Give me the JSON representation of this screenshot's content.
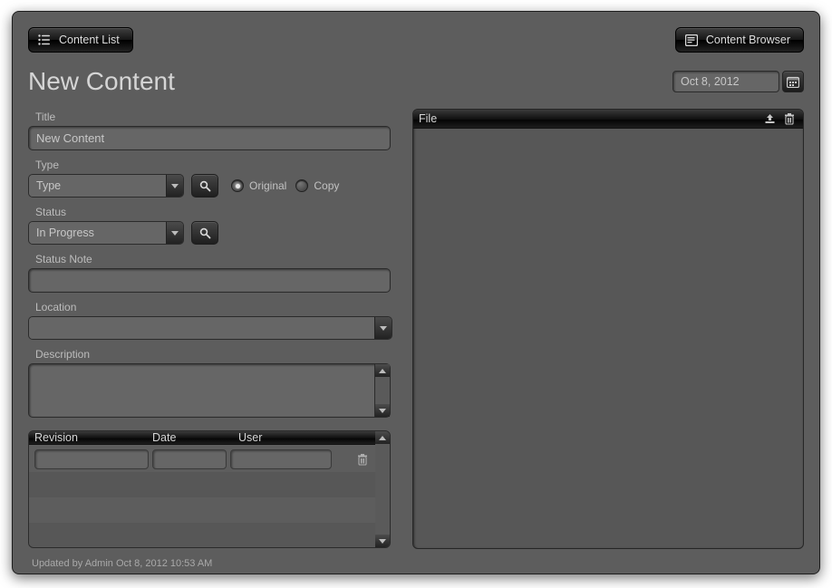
{
  "topbar": {
    "left_label": "Content List",
    "right_label": "Content Browser"
  },
  "page_title": "New Content",
  "date_value": "Oct 8, 2012",
  "form": {
    "title_label": "Title",
    "title_value": "New Content",
    "type_label": "Type",
    "type_value": "Type",
    "original_label": "Original",
    "copy_label": "Copy",
    "origin_selected": "Original",
    "status_label": "Status",
    "status_value": "In Progress",
    "status_note_label": "Status Note",
    "status_note_value": "",
    "location_label": "Location",
    "location_value": "",
    "description_label": "Description",
    "description_value": ""
  },
  "revision_table": {
    "columns": {
      "c1": "Revision",
      "c2": "Date",
      "c3": "User"
    },
    "rows": [
      {
        "revision": "",
        "date": "",
        "user": ""
      }
    ]
  },
  "file_panel": {
    "title": "File"
  },
  "status_line": "Updated by Admin Oct 8, 2012 10:53 AM"
}
